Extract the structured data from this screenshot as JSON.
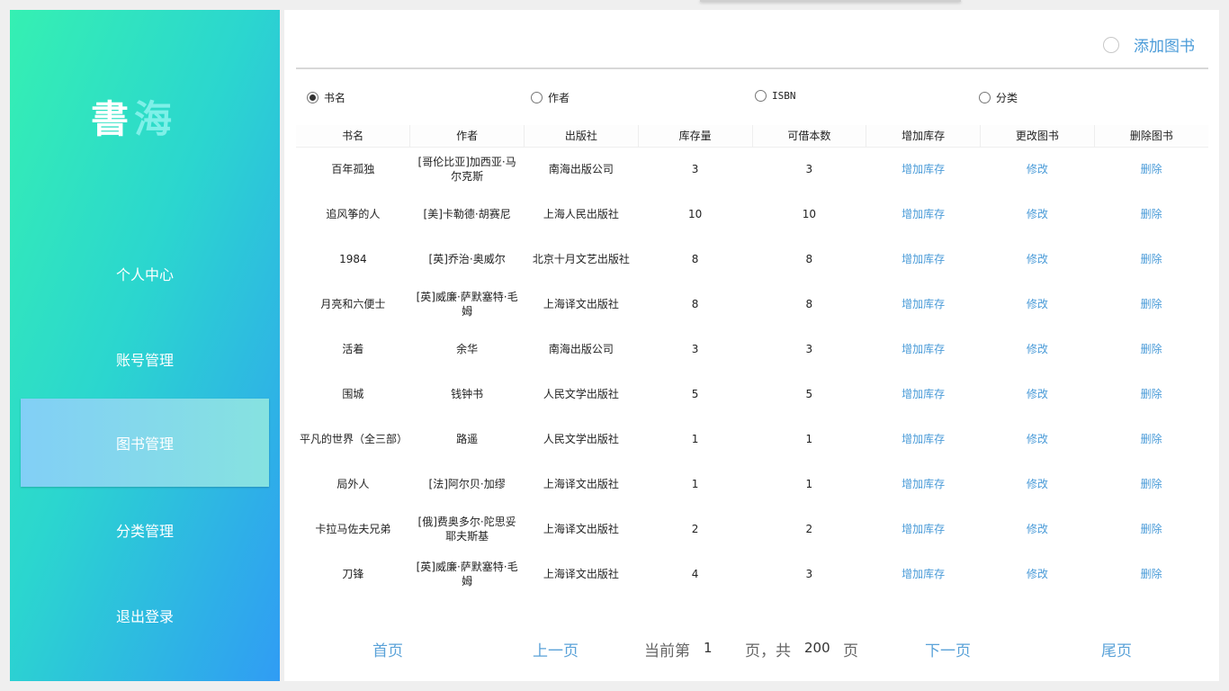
{
  "app": {
    "logo_main": "書",
    "logo_accent": "海"
  },
  "sidebar": {
    "items": [
      {
        "label": "个人中心"
      },
      {
        "label": "账号管理"
      },
      {
        "label": "图书管理"
      },
      {
        "label": "分类管理"
      },
      {
        "label": "退出登录"
      }
    ],
    "active_index": 2
  },
  "toolbar": {
    "add_label": "添加图书"
  },
  "search_by": {
    "options": [
      "书名",
      "作者",
      "ISBN",
      "分类"
    ],
    "selected": "书名"
  },
  "table": {
    "headers": [
      "书名",
      "作者",
      "出版社",
      "库存量",
      "可借本数",
      "增加库存",
      "更改图书",
      "删除图书"
    ],
    "rows": [
      {
        "title": "百年孤独",
        "author": "[哥伦比亚]加西亚·马尔克斯",
        "publisher": "南海出版公司",
        "stock": "3",
        "available": "3",
        "add": "增加库存",
        "edit": "修改",
        "delete": "删除"
      },
      {
        "title": "追风筝的人",
        "author": "[美]卡勒德·胡赛尼",
        "publisher": "上海人民出版社",
        "stock": "10",
        "available": "10",
        "add": "增加库存",
        "edit": "修改",
        "delete": "删除"
      },
      {
        "title": "1984",
        "author": "[英]乔治·奥威尔",
        "publisher": "北京十月文艺出版社",
        "stock": "8",
        "available": "8",
        "add": "增加库存",
        "edit": "修改",
        "delete": "删除"
      },
      {
        "title": "月亮和六便士",
        "author": "[英]威廉·萨默塞特·毛姆",
        "publisher": "上海译文出版社",
        "stock": "8",
        "available": "8",
        "add": "增加库存",
        "edit": "修改",
        "delete": "删除"
      },
      {
        "title": "活着",
        "author": "余华",
        "publisher": "南海出版公司",
        "stock": "3",
        "available": "3",
        "add": "增加库存",
        "edit": "修改",
        "delete": "删除"
      },
      {
        "title": "围城",
        "author": "钱钟书",
        "publisher": "人民文学出版社",
        "stock": "5",
        "available": "5",
        "add": "增加库存",
        "edit": "修改",
        "delete": "删除"
      },
      {
        "title": "平凡的世界（全三部）",
        "author": "路遥",
        "publisher": "人民文学出版社",
        "stock": "1",
        "available": "1",
        "add": "增加库存",
        "edit": "修改",
        "delete": "删除"
      },
      {
        "title": "局外人",
        "author": "[法]阿尔贝·加缪",
        "publisher": "上海译文出版社",
        "stock": "1",
        "available": "1",
        "add": "增加库存",
        "edit": "修改",
        "delete": "删除"
      },
      {
        "title": "卡拉马佐夫兄弟",
        "author": "[俄]费奥多尔·陀思妥耶夫斯基",
        "publisher": "上海译文出版社",
        "stock": "2",
        "available": "2",
        "add": "增加库存",
        "edit": "修改",
        "delete": "删除"
      },
      {
        "title": "刀锋",
        "author": "[英]威廉·萨默塞特·毛姆",
        "publisher": "上海译文出版社",
        "stock": "4",
        "available": "3",
        "add": "增加库存",
        "edit": "修改",
        "delete": "删除"
      }
    ]
  },
  "pagination": {
    "first": "首页",
    "prev": "上一页",
    "current_prefix": "当前第",
    "current_page": "1",
    "total_prefix": "页，共",
    "total_pages": "200",
    "total_suffix": "页",
    "next": "下一页",
    "last": "尾页"
  }
}
